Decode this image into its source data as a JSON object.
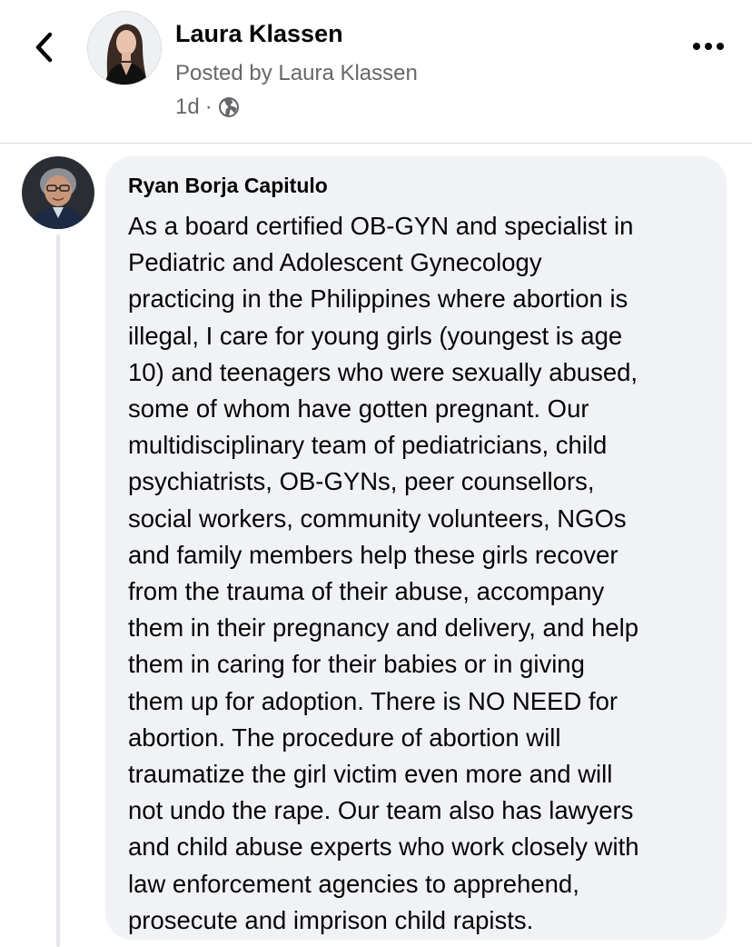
{
  "post": {
    "author_name": "Laura Klassen",
    "posted_by": "Posted by Laura Klassen",
    "time": "1d",
    "separator": "·",
    "icons": {
      "back": "chevron-left-icon",
      "more": "more-horizontal-icon",
      "audience": "globe-icon"
    }
  },
  "comment": {
    "author_name": "Ryan Borja Capitulo",
    "text": "As a board certified OB-GYN and specialist in\nPediatric and Adolescent Gynecology\npracticing in the Philippines where abortion is\nillegal, I care for young girls (youngest is age\n10) and teenagers who were sexually abused,\nsome of whom have gotten pregnant. Our\nmultidisciplinary team of pediatricians, child\npsychiatrists, OB-GYNs, peer counsellors,\nsocial workers, community volunteers, NGOs\nand family members help these girls recover\nfrom the trauma of their abuse, accompany\nthem in their pregnancy and delivery, and help\nthem in caring for their babies or in giving\nthem up for adoption. There is NO NEED for\nabortion. The procedure of abortion will\ntraumatize the girl victim even more and will\nnot undo the rape. Our team also has lawyers\nand child abuse experts who work closely with\nlaw enforcement agencies to apprehend,\nprosecute and imprison child rapists."
  },
  "colors": {
    "bubble_bg": "#f0f2f5",
    "secondary_text": "#65676b",
    "primary_text": "#050505",
    "divider": "#d6d8dc"
  }
}
